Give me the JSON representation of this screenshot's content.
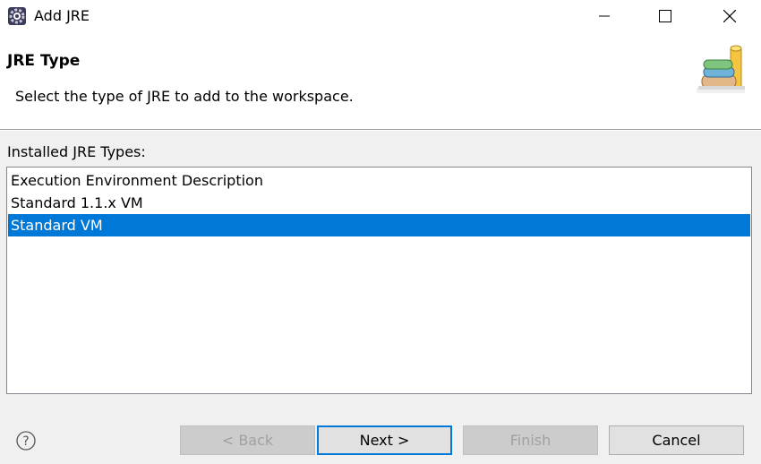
{
  "window": {
    "title": "Add JRE",
    "icon": "eclipse-gear-icon"
  },
  "banner": {
    "title": "JRE Type",
    "description": "Select the type of JRE to add to the workspace.",
    "image": "books-wizard-icon"
  },
  "list": {
    "label": "Installed JRE Types:",
    "items": [
      {
        "label": "Execution Environment Description",
        "selected": false
      },
      {
        "label": "Standard 1.1.x VM",
        "selected": false
      },
      {
        "label": "Standard VM",
        "selected": true
      }
    ]
  },
  "buttons": {
    "back": "< Back",
    "next": "Next >",
    "finish": "Finish",
    "cancel": "Cancel"
  },
  "colors": {
    "selection": "#0078d7",
    "window_bg": "#f0f0f0"
  }
}
